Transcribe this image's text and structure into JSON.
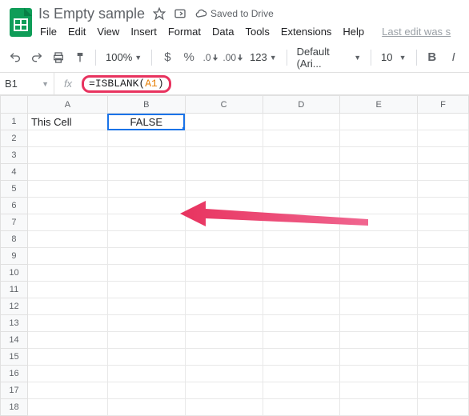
{
  "header": {
    "doc_title": "Is Empty sample",
    "saved_text": "Saved to Drive",
    "menu": [
      "File",
      "Edit",
      "View",
      "Insert",
      "Format",
      "Data",
      "Tools",
      "Extensions",
      "Help"
    ],
    "last_edit": "Last edit was s"
  },
  "toolbar": {
    "zoom": "100%",
    "currency": "$",
    "percent": "%",
    "dec_dec": ".0",
    "dec_inc": ".00",
    "more_formats": "123",
    "font": "Default (Ari...",
    "font_size": "10",
    "bold": "B",
    "italic": "I"
  },
  "formula_bar": {
    "cell_ref": "B1",
    "fx_label": "fx",
    "formula_eq": "=",
    "formula_fn": "ISBLANK",
    "formula_open": "(",
    "formula_arg": "A1",
    "formula_close": ")"
  },
  "grid": {
    "columns": [
      "A",
      "B",
      "C",
      "D",
      "E",
      "F"
    ],
    "rows": [
      "1",
      "2",
      "3",
      "4",
      "5",
      "6",
      "7",
      "8",
      "9",
      "10",
      "11",
      "12",
      "13",
      "14",
      "15",
      "16",
      "17",
      "18"
    ],
    "cells": {
      "A1": "This Cell",
      "B1": "FALSE"
    },
    "active_cell": "B1"
  }
}
